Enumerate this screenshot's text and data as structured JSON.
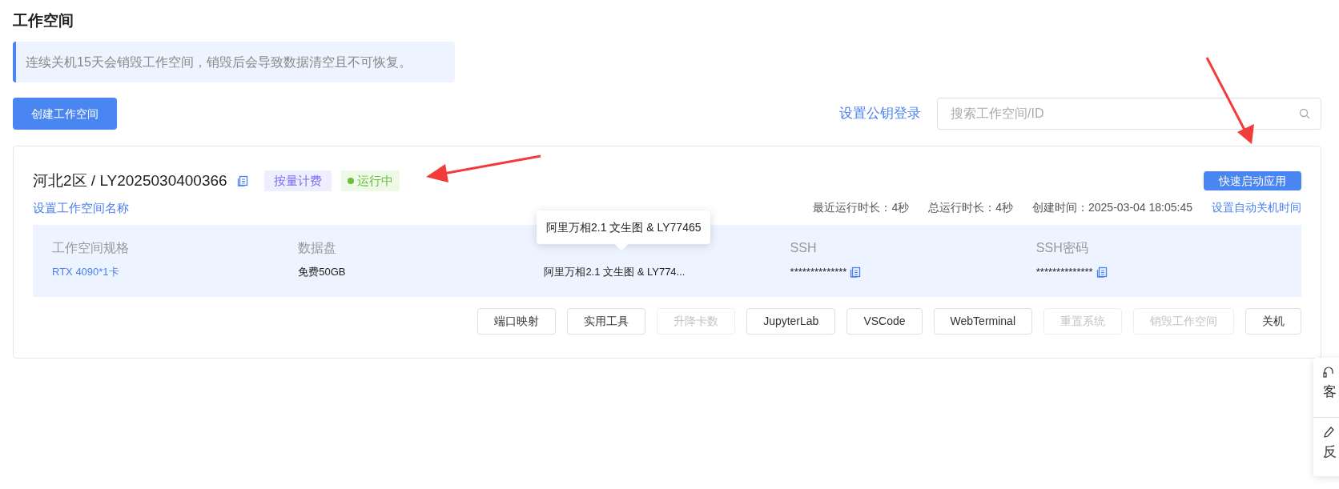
{
  "page_title": "工作空间",
  "notice": "连续关机15天会销毁工作空间，销毁后会导致数据清空且不可恢复。",
  "create_button": "创建工作空间",
  "pubkey_link": "设置公钥登录",
  "search": {
    "placeholder": "搜索工作空间/ID"
  },
  "workspace": {
    "title": "河北2区 / LY2025030400366",
    "billing_tag": "按量计费",
    "status": {
      "label": "运行中",
      "color": "#67c23a"
    },
    "quick_start_button": "快速启动应用",
    "rename_link": "设置工作空间名称",
    "meta": [
      "最近运行时长：4秒",
      "总运行时长：4秒",
      "创建时间：2025-03-04 18:05:45"
    ],
    "auto_shutdown_link": "设置自动关机时间",
    "specs": [
      {
        "kind": "link",
        "label": "工作空间规格",
        "value": "RTX 4090*1卡",
        "copy": false
      },
      {
        "kind": "text",
        "label": "数据盘",
        "value": "免费50GB",
        "copy": false
      },
      {
        "kind": "text",
        "value": "阿里万相2.1 文生图 & LY774...",
        "copy": false
      },
      {
        "kind": "text",
        "label": "SSH",
        "value": "**************",
        "copy": true
      },
      {
        "kind": "text",
        "label": "SSH密码",
        "value": "**************",
        "copy": true
      }
    ],
    "tooltip": "阿里万相2.1 文生图 & LY77465",
    "actions": [
      {
        "label": "端口映射",
        "disabled": false
      },
      {
        "label": "实用工具",
        "disabled": false
      },
      {
        "label": "升降卡数",
        "disabled": true
      },
      {
        "label": "JupyterLab",
        "disabled": false
      },
      {
        "label": "VSCode",
        "disabled": false
      },
      {
        "label": "WebTerminal",
        "disabled": false
      },
      {
        "label": "重置系统",
        "disabled": true
      },
      {
        "label": "销毁工作空间",
        "disabled": true
      },
      {
        "label": "关机",
        "disabled": false
      }
    ]
  },
  "float_tabs": [
    {
      "kind": "headset",
      "label": "客"
    },
    {
      "kind": "pencil",
      "label": "反"
    }
  ]
}
